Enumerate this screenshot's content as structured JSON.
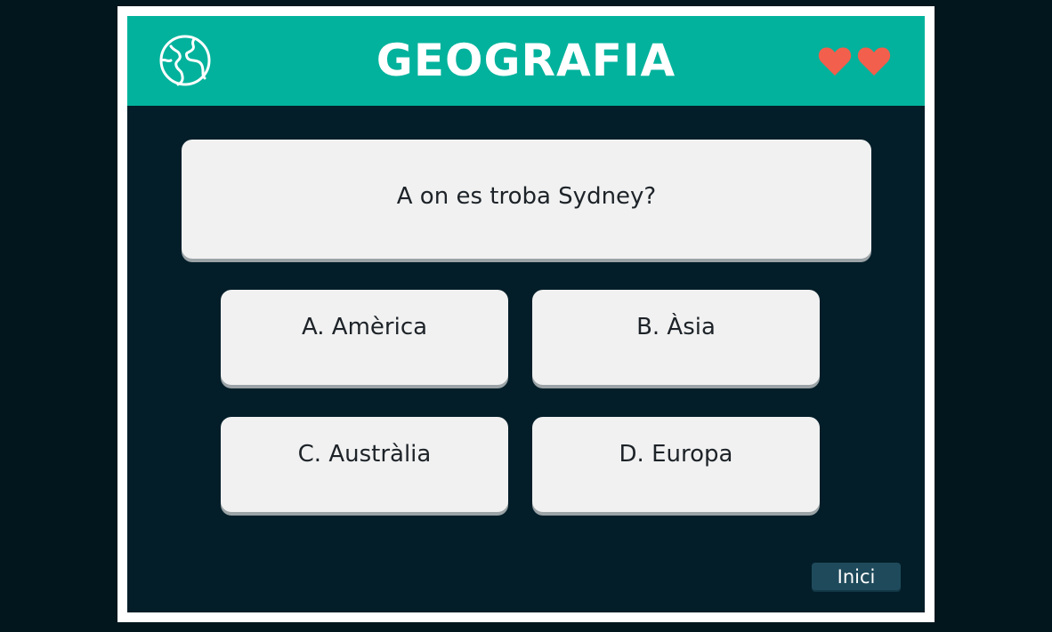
{
  "header": {
    "title": "GEOGRAFIA",
    "icon": "globe-icon",
    "lives": 2,
    "heart_color": "#f25f4c",
    "background": "#02b29c"
  },
  "question": {
    "text": "A on es troba Sydney?"
  },
  "answers": [
    {
      "label": "A. Amèrica"
    },
    {
      "label": "B. Àsia"
    },
    {
      "label": "C. Austràlia"
    },
    {
      "label": "D. Europa"
    }
  ],
  "footer": {
    "home_label": "Inici"
  },
  "colors": {
    "page_background": "#01161d",
    "stage_background": "#031e29",
    "card_background": "#f1f1f1",
    "button_background": "#1f4a5b"
  }
}
